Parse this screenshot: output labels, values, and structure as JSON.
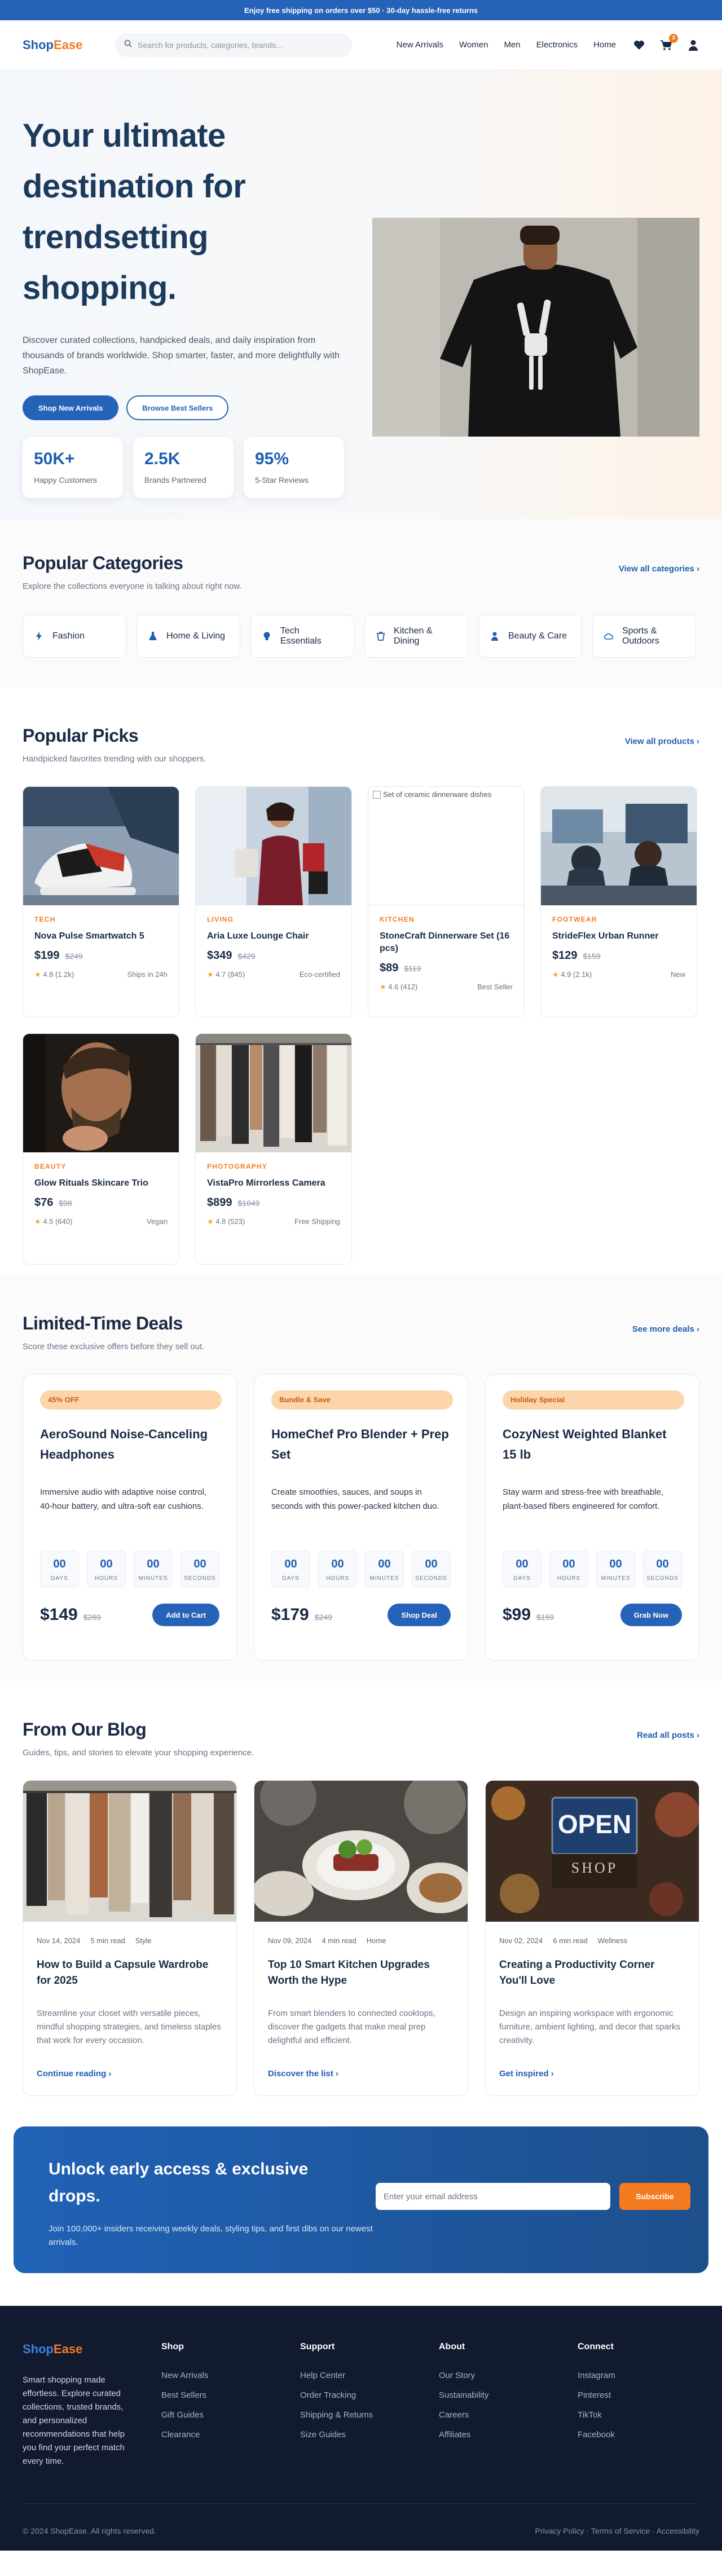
{
  "topbar": {
    "text": "Enjoy free shipping on orders over $50 · 30-day hassle-free returns"
  },
  "header": {
    "logo_shop": "Shop",
    "logo_ease": "Ease",
    "search_placeholder": "Search for products, categories, brands...",
    "nav": [
      "New Arrivals",
      "Women",
      "Men",
      "Electronics",
      "Home"
    ],
    "cart_count": "3",
    "icons": [
      "search-icon",
      "heart-icon",
      "cart-icon",
      "user-icon"
    ]
  },
  "hero": {
    "title": "Your ultimate destination for trendsetting shopping.",
    "subtitle": "Discover curated collections, handpicked deals, and daily inspiration from thousands of brands worldwide. Shop smarter, faster, and more delightfully with ShopEase.",
    "primary_btn": "Shop New Arrivals",
    "secondary_btn": "Browse Best Sellers",
    "stats": [
      {
        "value": "50K+",
        "label": "Happy Customers"
      },
      {
        "value": "2.5K",
        "label": "Brands Partnered"
      },
      {
        "value": "95%",
        "label": "5-Star Reviews"
      }
    ]
  },
  "categories": {
    "title": "Popular Categories",
    "subtitle": "Explore the collections everyone is talking about right now.",
    "link": "View all categories ›",
    "items": [
      {
        "label": "Fashion",
        "icon": "bolt-icon"
      },
      {
        "label": "Home & Living",
        "icon": "flask-icon"
      },
      {
        "label": "Tech Essentials",
        "icon": "lightbulb-icon"
      },
      {
        "label": "Kitchen & Dining",
        "icon": "cup-icon"
      },
      {
        "label": "Beauty & Care",
        "icon": "person-icon"
      },
      {
        "label": "Sports & Outdoors",
        "icon": "cloud-icon"
      }
    ]
  },
  "picks": {
    "title": "Popular Picks",
    "subtitle": "Handpicked favorites trending with our shoppers.",
    "link": "View all products ›",
    "items": [
      {
        "category": "TECH",
        "name": "Nova Pulse Smartwatch 5",
        "price": "$199",
        "old": "$249",
        "rating": "4.8 (1.2k)",
        "note": "Ships in 24h",
        "img": "sneakers"
      },
      {
        "category": "LIVING",
        "name": "Aria Luxe Lounge Chair",
        "price": "$349",
        "old": "$429",
        "rating": "4.7 (845)",
        "note": "Eco-certified",
        "img": "shopper"
      },
      {
        "category": "KITCHEN",
        "name": "StoneCraft Dinnerware Set (16 pcs)",
        "price": "$89",
        "old": "$119",
        "rating": "4.6 (412)",
        "note": "Best Seller",
        "img": "broken",
        "alt": "Set of ceramic dinnerware dishes"
      },
      {
        "category": "FOOTWEAR",
        "name": "StrideFlex Urban Runner",
        "price": "$129",
        "old": "$159",
        "rating": "4.9 (2.1k)",
        "note": "New",
        "img": "desk"
      },
      {
        "category": "BEAUTY",
        "name": "Glow Rituals Skincare Trio",
        "price": "$76",
        "old": "$98",
        "rating": "4.5 (640)",
        "note": "Vegan",
        "img": "man"
      },
      {
        "category": "PHOTOGRAPHY",
        "name": "VistaPro Mirrorless Camera",
        "price": "$899",
        "old": "$1049",
        "rating": "4.8 (523)",
        "note": "Free Shipping",
        "img": "rack"
      }
    ]
  },
  "deals": {
    "title": "Limited-Time Deals",
    "subtitle": "Score these exclusive offers before they sell out.",
    "link": "See more deals ›",
    "timer_labels": [
      "DAYS",
      "HOURS",
      "MINUTES",
      "SECONDS"
    ],
    "items": [
      {
        "badge": "45% OFF",
        "name": "AeroSound Noise-Canceling Headphones",
        "desc": "Immersive audio with adaptive noise control, 40-hour battery, and ultra-soft ear cushions.",
        "timer": [
          "00",
          "00",
          "00",
          "00"
        ],
        "price": "$149",
        "old": "$269",
        "cta": "Add to Cart"
      },
      {
        "badge": "Bundle & Save",
        "name": "HomeChef Pro Blender + Prep Set",
        "desc": "Create smoothies, sauces, and soups in seconds with this power-packed kitchen duo.",
        "timer": [
          "00",
          "00",
          "00",
          "00"
        ],
        "price": "$179",
        "old": "$249",
        "cta": "Shop Deal"
      },
      {
        "badge": "Holiday Special",
        "name": "CozyNest Weighted Blanket 15 lb",
        "desc": "Stay warm and stress-free with breathable, plant-based fibers engineered for comfort.",
        "timer": [
          "00",
          "00",
          "00",
          "00"
        ],
        "price": "$99",
        "old": "$159",
        "cta": "Grab Now"
      }
    ]
  },
  "blog": {
    "title": "From Our Blog",
    "subtitle": "Guides, tips, and stories to elevate your shopping experience.",
    "link": "Read all posts ›",
    "items": [
      {
        "date": "Nov 14, 2024",
        "read": "5 min read",
        "tag": "Style",
        "title": "How to Build a Capsule Wardrobe for 2025",
        "excerpt": "Streamline your closet with versatile pieces, mindful shopping strategies, and timeless staples that work for every occasion.",
        "cta": "Continue reading ›",
        "img": "clothes"
      },
      {
        "date": "Nov 09, 2024",
        "read": "4 min read",
        "tag": "Home",
        "title": "Top 10 Smart Kitchen Upgrades Worth the Hype",
        "excerpt": "From smart blenders to connected cooktops, discover the gadgets that make meal prep delightful and efficient.",
        "cta": "Discover the list ›",
        "img": "food"
      },
      {
        "date": "Nov 02, 2024",
        "read": "6 min read",
        "tag": "Wellness",
        "title": "Creating a Productivity Corner You'll Love",
        "excerpt": "Design an inspiring workspace with ergonomic furniture, ambient lighting, and decor that sparks creativity.",
        "cta": "Get inspired ›",
        "img": "open",
        "sign_open": "OPEN",
        "sign_shop": "SHOP"
      }
    ]
  },
  "newsletter": {
    "title": "Unlock early access & exclusive drops.",
    "text": "Join 100,000+ insiders receiving weekly deals, styling tips, and first dibs on our newest arrivals.",
    "placeholder": "Enter your email address",
    "button": "Subscribe"
  },
  "footer": {
    "logo_shop": "Shop",
    "logo_ease": "Ease",
    "desc": "Smart shopping made effortless. Explore curated collections, trusted brands, and personalized recommendations that help you find your perfect match every time.",
    "columns": [
      {
        "title": "Shop",
        "links": [
          "New Arrivals",
          "Best Sellers",
          "Gift Guides",
          "Clearance"
        ]
      },
      {
        "title": "Support",
        "links": [
          "Help Center",
          "Order Tracking",
          "Shipping & Returns",
          "Size Guides"
        ]
      },
      {
        "title": "About",
        "links": [
          "Our Story",
          "Sustainability",
          "Careers",
          "Affiliates"
        ]
      },
      {
        "title": "Connect",
        "links": [
          "Instagram",
          "Pinterest",
          "TikTok",
          "Facebook"
        ]
      }
    ],
    "copyright": "© 2024 ShopEase. All rights reserved.",
    "legal": "Privacy Policy · Terms of Service · Accessibility"
  },
  "colors": {
    "brand_blue": "#2563b8",
    "accent_orange": "#f47b20",
    "footer_bg": "#111a2e"
  }
}
